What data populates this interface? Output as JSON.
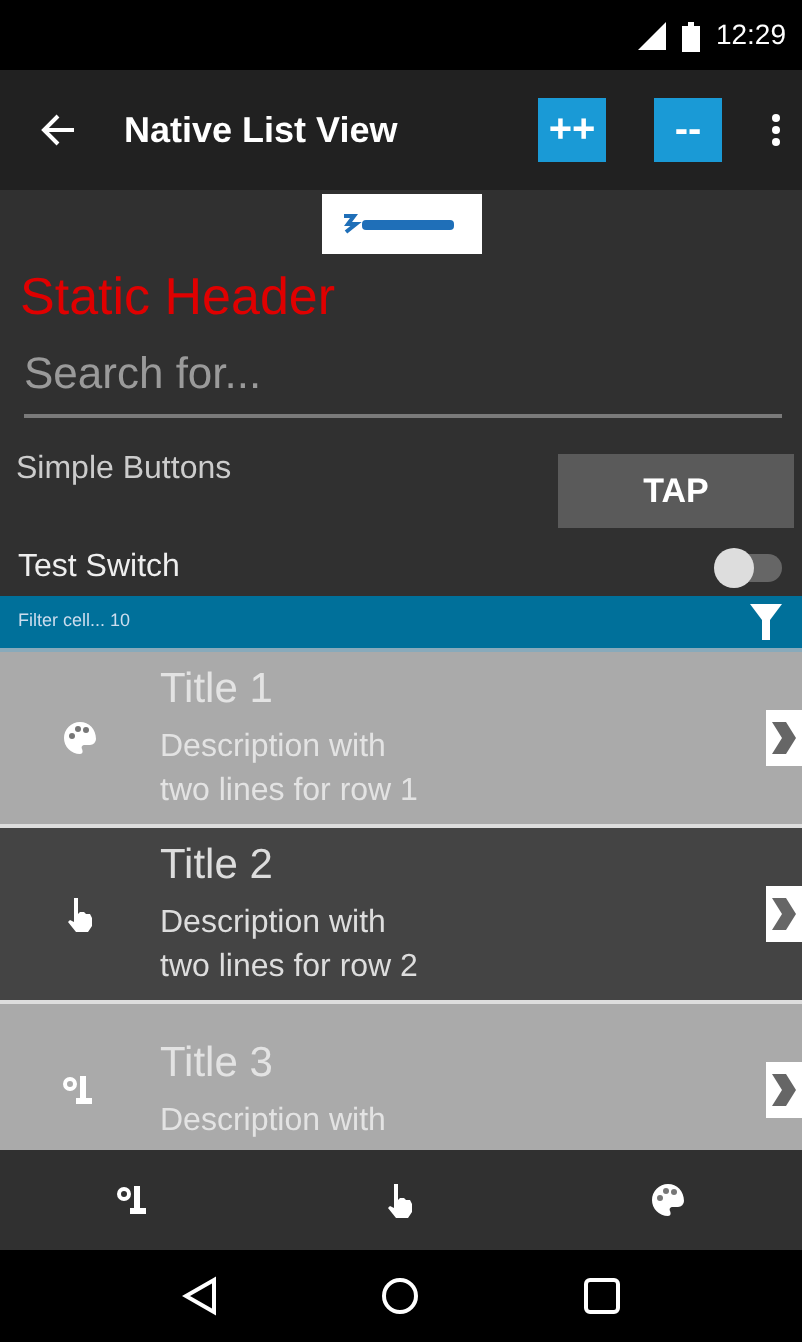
{
  "status_bar": {
    "time": "12:29"
  },
  "toolbar": {
    "title": "Native List View",
    "buttons": [
      "++",
      "--"
    ]
  },
  "static_header": "Static Header",
  "search": {
    "placeholder": "Search for..."
  },
  "simple_buttons": {
    "label": "Simple Buttons",
    "button": "TAP"
  },
  "test_switch": {
    "label": "Test Switch",
    "on": false
  },
  "filter_bar": {
    "text": "Filter cell... 10"
  },
  "rows": [
    {
      "title": "Title 1",
      "description": "Description with\ntwo lines for row 1",
      "selected": false
    },
    {
      "title": "Title 2",
      "description": "Description with\ntwo lines for row 2",
      "selected": true
    },
    {
      "title": "Title 3",
      "description": "Description with",
      "selected": false
    }
  ]
}
